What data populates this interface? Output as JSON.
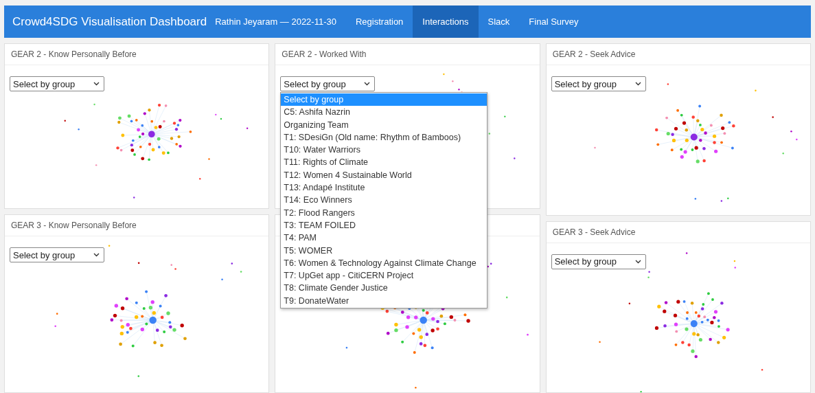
{
  "navbar": {
    "title": "Crowd4SDG Visualisation Dashboard",
    "subtitle": "Rathin Jeyaram — 2022-11-30",
    "tabs": [
      {
        "label": "Registration",
        "selected": false
      },
      {
        "label": "Interactions",
        "selected": true
      },
      {
        "label": "Slack",
        "selected": false
      },
      {
        "label": "Final Survey",
        "selected": false
      }
    ]
  },
  "panels": [
    {
      "kind": "network",
      "title": "GEAR 2 - Know Personally Before",
      "select": "Select by group"
    },
    {
      "kind": "network",
      "title": "GEAR 3 - Know Personally Before",
      "select": "Select by group"
    },
    {
      "kind": "network",
      "title": "GEAR 2 - Worked With",
      "select": "Select by group",
      "options": [
        {
          "label": "Select by group",
          "selected": true
        },
        {
          "label": "C5: Ashifa Nazrin",
          "selected": false
        },
        {
          "label": "Organizing Team",
          "selected": false
        },
        {
          "label": "T1: SDesiGn (Old name: Rhythm of Bamboos)",
          "selected": false
        },
        {
          "label": "T10: Water Warriors",
          "selected": false
        },
        {
          "label": "T11: Rights of Climate",
          "selected": false
        },
        {
          "label": "T12: Women 4 Sustainable World",
          "selected": false
        },
        {
          "label": "T13: Andapé Institute",
          "selected": false
        },
        {
          "label": "T14: Eco Winners",
          "selected": false
        },
        {
          "label": "T2: Flood Rangers",
          "selected": false
        },
        {
          "label": "T3: TEAM FOILED",
          "selected": false
        },
        {
          "label": "T4: PAM",
          "selected": false
        },
        {
          "label": "T5: WOMER",
          "selected": false
        },
        {
          "label": "T6: Women & Technology Against Climate Change",
          "selected": false
        },
        {
          "label": "T7: UpGet app - CitiCERN Project",
          "selected": false
        },
        {
          "label": "T8: Climate Gender Justice",
          "selected": false
        },
        {
          "label": "T9: DonateWater",
          "selected": false
        }
      ]
    },
    {
      "kind": "network"
    },
    {
      "kind": "network",
      "title": "GEAR 2 - Seek Advice",
      "select": "Select by group"
    },
    {
      "kind": "network",
      "title": "GEAR 3 - Seek Advice",
      "select": "Select by group"
    }
  ]
}
